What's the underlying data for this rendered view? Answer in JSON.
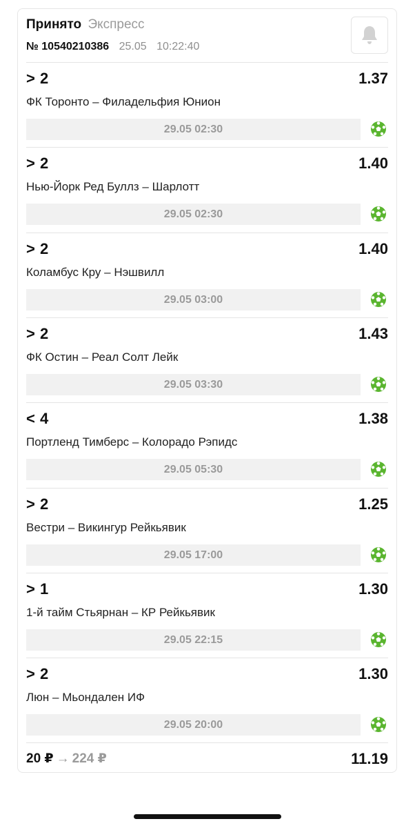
{
  "header": {
    "status": "Принято",
    "bet_type": "Экспресс",
    "bet_number": "№ 10540210386",
    "date": "25.05",
    "time": "10:22:40"
  },
  "events": [
    {
      "outcome": "> 2",
      "coef": "1.37",
      "match": "ФК Торонто – Филадельфия Юнион",
      "datetime": "29.05 02:30",
      "sport_icon": "soccer-ball-icon"
    },
    {
      "outcome": "> 2",
      "coef": "1.40",
      "match": "Нью-Йорк Ред Буллз – Шарлотт",
      "datetime": "29.05 02:30",
      "sport_icon": "soccer-ball-icon"
    },
    {
      "outcome": "> 2",
      "coef": "1.40",
      "match": "Коламбус Кру – Нэшвилл",
      "datetime": "29.05 03:00",
      "sport_icon": "soccer-ball-icon"
    },
    {
      "outcome": "> 2",
      "coef": "1.43",
      "match": "ФК Остин – Реал Солт Лейк",
      "datetime": "29.05 03:30",
      "sport_icon": "soccer-ball-icon"
    },
    {
      "outcome": "< 4",
      "coef": "1.38",
      "match": "Портленд Тимберс – Колорадо Рэпидс",
      "datetime": "29.05 05:30",
      "sport_icon": "soccer-ball-icon"
    },
    {
      "outcome": "> 2",
      "coef": "1.25",
      "match": "Вестри – Викингур Рейкьявик",
      "datetime": "29.05 17:00",
      "sport_icon": "soccer-ball-icon"
    },
    {
      "outcome": "> 1",
      "coef": "1.30",
      "match": "1-й тайм Стьярнан – КР Рейкьявик",
      "datetime": "29.05 22:15",
      "sport_icon": "soccer-ball-icon"
    },
    {
      "outcome": "> 2",
      "coef": "1.30",
      "match": "Люн – Мьондален ИФ",
      "datetime": "29.05 20:00",
      "sport_icon": "soccer-ball-icon"
    }
  ],
  "footer": {
    "stake": "20 ₽",
    "arrow": "→",
    "payout": "224 ₽",
    "total_coef": "11.19"
  },
  "colors": {
    "accent_green": "#5ab52f",
    "muted_text": "#9a9a9a",
    "datebar_bg": "#f1f1f1"
  }
}
